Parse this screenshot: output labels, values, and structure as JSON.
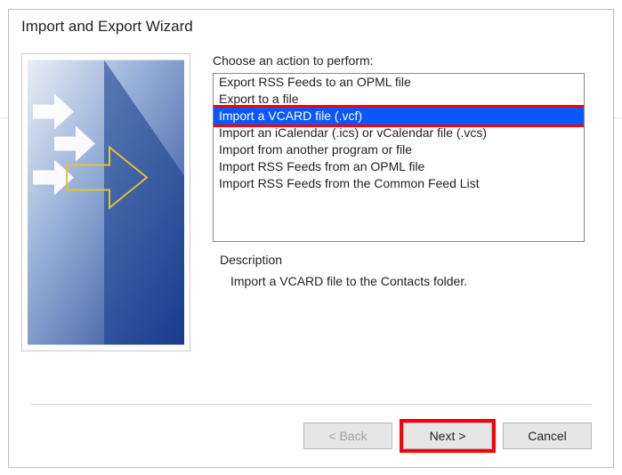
{
  "dialog": {
    "title": "Import and Export Wizard",
    "prompt": "Choose an action to perform:",
    "actions": [
      "Export RSS Feeds to an OPML file",
      "Export to a file",
      "Import a VCARD file (.vcf)",
      "Import an iCalendar (.ics) or vCalendar file (.vcs)",
      "Import from another program or file",
      "Import RSS Feeds from an OPML file",
      "Import RSS Feeds from the Common Feed List"
    ],
    "selected_index": 2,
    "description_label": "Description",
    "description_text": "Import a VCARD file to the Contacts folder."
  },
  "buttons": {
    "back": "< Back",
    "next": "Next >",
    "cancel": "Cancel"
  }
}
